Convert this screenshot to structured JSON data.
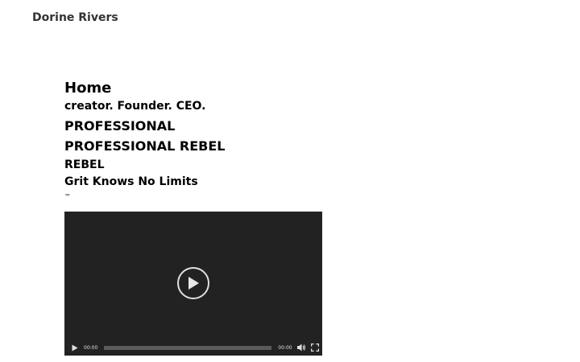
{
  "site": {
    "title": "Dorine Rivers"
  },
  "page": {
    "title": "Home",
    "lines": [
      "creator. Founder. CEO.",
      "PROFESSIONAL",
      "PROFESSIONAL REBEL",
      "REBEL",
      "Grit Knows No Limits"
    ],
    "trademark": "™"
  },
  "video": {
    "current_time": "00:00",
    "duration": "00:00",
    "progress": 0,
    "icons": {
      "big_play": "play-circle-icon",
      "play": "play-icon",
      "volume": "volume-icon",
      "fullscreen": "fullscreen-icon"
    },
    "colors": {
      "background": "#222222",
      "controls": "#e0e0e0",
      "track": "#5a5a5a"
    }
  }
}
